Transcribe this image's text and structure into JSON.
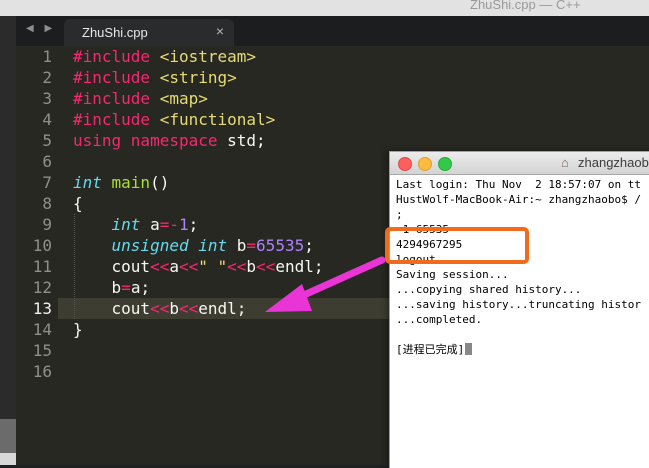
{
  "window": {
    "title": "ZhuShi.cpp — C++"
  },
  "tabbar": {
    "nav_arrows": "◀ ▶",
    "tab_name": "ZhuShi.cpp",
    "close_glyph": "×"
  },
  "editor": {
    "line_numbers": [
      "1",
      "2",
      "3",
      "4",
      "5",
      "6",
      "7",
      "8",
      "9",
      "10",
      "11",
      "12",
      "13",
      "14",
      "15",
      "16"
    ],
    "current_line": 13,
    "lines": [
      [
        {
          "t": "#include ",
          "c": "pink"
        },
        {
          "t": "<iostream>",
          "c": "yel"
        }
      ],
      [
        {
          "t": "#include ",
          "c": "pink"
        },
        {
          "t": "<string>",
          "c": "yel"
        }
      ],
      [
        {
          "t": "#include ",
          "c": "pink"
        },
        {
          "t": "<map>",
          "c": "yel"
        }
      ],
      [
        {
          "t": "#include ",
          "c": "pink"
        },
        {
          "t": "<functional>",
          "c": "yel"
        }
      ],
      [
        {
          "t": "using namespace ",
          "c": "pink"
        },
        {
          "t": "std;",
          "c": ""
        }
      ],
      [],
      [
        {
          "t": "int ",
          "c": "blu"
        },
        {
          "t": "main",
          "c": "grn"
        },
        {
          "t": "()",
          "c": ""
        }
      ],
      [
        {
          "t": "{",
          "c": ""
        }
      ],
      [
        {
          "t": "    ",
          "c": ""
        },
        {
          "t": "int ",
          "c": "blu"
        },
        {
          "t": "a",
          "c": ""
        },
        {
          "t": "=-",
          "c": "pink"
        },
        {
          "t": "1",
          "c": "pur"
        },
        {
          "t": ";",
          "c": ""
        }
      ],
      [
        {
          "t": "    ",
          "c": ""
        },
        {
          "t": "unsigned int ",
          "c": "blu"
        },
        {
          "t": "b",
          "c": ""
        },
        {
          "t": "=",
          "c": "pink"
        },
        {
          "t": "65535",
          "c": "pur"
        },
        {
          "t": ";",
          "c": ""
        }
      ],
      [
        {
          "t": "    cout",
          "c": ""
        },
        {
          "t": "<<",
          "c": "pink"
        },
        {
          "t": "a",
          "c": ""
        },
        {
          "t": "<<",
          "c": "pink"
        },
        {
          "t": "\" \"",
          "c": "yel"
        },
        {
          "t": "<<",
          "c": "pink"
        },
        {
          "t": "b",
          "c": ""
        },
        {
          "t": "<<",
          "c": "pink"
        },
        {
          "t": "endl;",
          "c": ""
        }
      ],
      [
        {
          "t": "    b",
          "c": ""
        },
        {
          "t": "=",
          "c": "pink"
        },
        {
          "t": "a;",
          "c": ""
        }
      ],
      [
        {
          "t": "    cout",
          "c": ""
        },
        {
          "t": "<<",
          "c": "pink"
        },
        {
          "t": "b",
          "c": ""
        },
        {
          "t": "<<",
          "c": "pink"
        },
        {
          "t": "endl;",
          "c": ""
        }
      ],
      [
        {
          "t": "}",
          "c": ""
        }
      ],
      [],
      []
    ]
  },
  "terminal": {
    "title": "zhangzhaobo",
    "home_glyph": "⌂",
    "lines": [
      "Last login: Thu Nov  2 18:57:07 on tt",
      "HustWolf-MacBook-Air:~ zhangzhaobo$ /",
      ";",
      "-1 65535",
      "4294967295",
      "logout",
      "Saving session...",
      "...copying shared history...",
      "...saving history...truncating histor",
      "...completed.",
      "",
      "[进程已完成]"
    ]
  },
  "colors": {
    "editor_bg": "#272822",
    "keyword_pink": "#f92672",
    "string_yellow": "#e6db74",
    "type_blue": "#66d9ef",
    "func_green": "#a6e22e",
    "number_purple": "#ae81ff",
    "annotation_orange": "#f26a1b",
    "annotation_magenta": "#e934d6"
  },
  "annotations": {
    "box": "orange-highlight-box",
    "arrow": "magenta-arrow"
  }
}
